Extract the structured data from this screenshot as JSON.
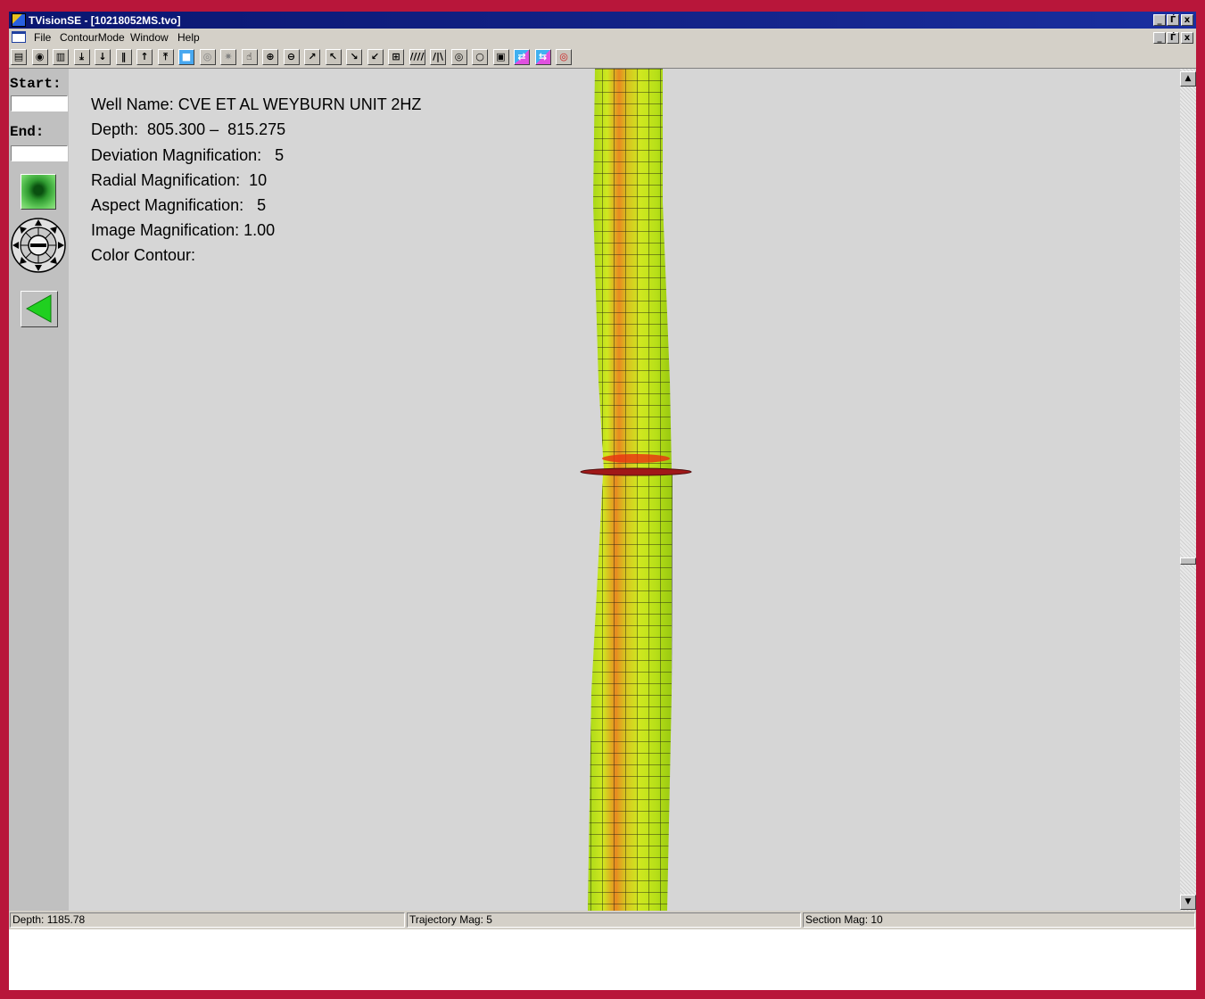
{
  "window": {
    "title": "TVisionSE - [10218052MS.tvo]",
    "controls": [
      "_",
      "Ѓ",
      "x"
    ]
  },
  "menu": {
    "items": [
      "File",
      "ContourMode",
      "Window",
      "Help"
    ]
  },
  "toolbar": {
    "buttons": [
      {
        "glyph": "▤",
        "name": "open-icon"
      },
      {
        "glyph": "◉",
        "name": "camera-icon"
      },
      {
        "glyph": "▥",
        "name": "film-icon"
      },
      {
        "glyph": "⤓",
        "name": "goto-end-icon"
      },
      {
        "glyph": "↓",
        "name": "down-arrow-icon"
      },
      {
        "glyph": "‖",
        "name": "pause-icon"
      },
      {
        "glyph": "↑",
        "name": "up-arrow-icon"
      },
      {
        "glyph": "⤒",
        "name": "goto-start-icon"
      },
      {
        "glyph": "■",
        "name": "blue-select-icon"
      },
      {
        "glyph": "◎",
        "name": "disabled-target-icon"
      },
      {
        "glyph": "✷",
        "name": "disabled-move-icon"
      },
      {
        "glyph": "☝",
        "name": "pan-hand-icon"
      },
      {
        "glyph": "⊕",
        "name": "zoom-in-icon"
      },
      {
        "glyph": "⊖",
        "name": "zoom-out-icon"
      },
      {
        "glyph": "↗",
        "name": "rotate-plus-icon"
      },
      {
        "glyph": "↖",
        "name": "rotate-minus-icon"
      },
      {
        "glyph": "↘",
        "name": "tilt-plus-icon"
      },
      {
        "glyph": "↙",
        "name": "tilt-minus-icon"
      },
      {
        "glyph": "⊞",
        "name": "grid-icon"
      },
      {
        "glyph": "////",
        "name": "hatch-icon"
      },
      {
        "glyph": "/|\\",
        "name": "lines-icon"
      },
      {
        "glyph": "◎",
        "name": "section-icon"
      },
      {
        "glyph": "○",
        "name": "circle-icon"
      },
      {
        "glyph": "▣",
        "name": "contour-box-icon"
      },
      {
        "glyph": "⇄",
        "name": "color-map-icon"
      },
      {
        "glyph": "⇆",
        "name": "color-map-alt-icon"
      },
      {
        "glyph": "◎",
        "name": "target-icon"
      }
    ]
  },
  "left_panel": {
    "start_label": "Start:",
    "start_value": "",
    "end_label": "End:",
    "end_value": ""
  },
  "info": {
    "lines": [
      "Well Name: CVE ET AL WEYBURN UNIT 2HZ",
      "Depth:  805.300 –  815.275",
      "Deviation Magnification:   5",
      "Radial Magnification:  10",
      "Aspect Magnification:   5",
      "Image Magnification: 1.00",
      "Color Contour:"
    ]
  },
  "scrollbar": {
    "up": "▲",
    "down": "▼"
  },
  "status": {
    "depth": "Depth: 1185.78",
    "trajectory": "Trajectory Mag: 5",
    "section": "Section Mag: 10"
  },
  "colors": {
    "frame": "#b8163a",
    "tube_yellow": "#c8e818",
    "tube_orange": "#e87820",
    "canvas": "#d6d6d6"
  }
}
